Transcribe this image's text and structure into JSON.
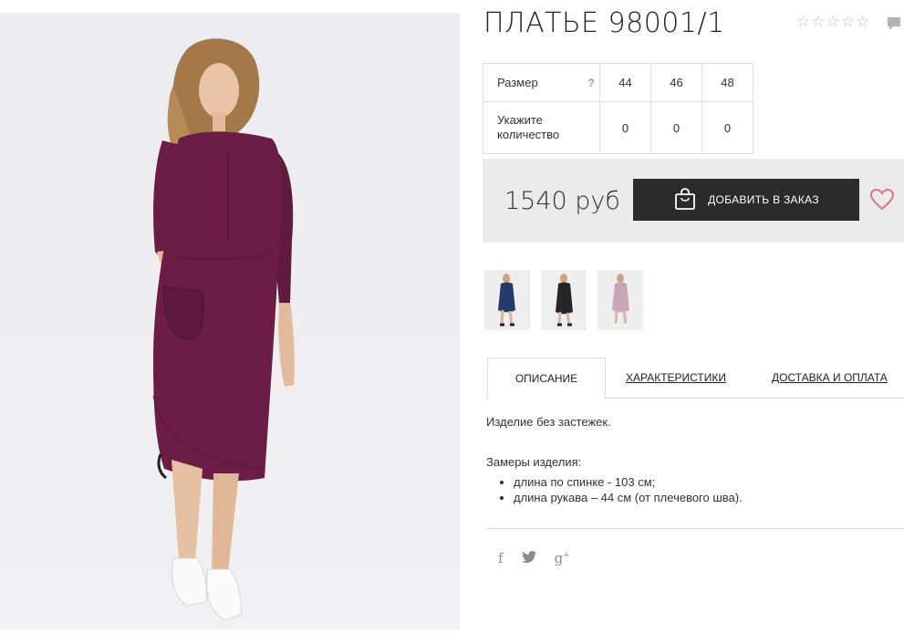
{
  "product": {
    "title": "ПЛАТЬЕ 98001/1",
    "rating_stars": 5
  },
  "sizes": {
    "size_label": "Размер",
    "help_label": "?",
    "qty_label": "Укажите количество",
    "columns": [
      {
        "size": "44",
        "qty": "0"
      },
      {
        "size": "46",
        "qty": "0"
      },
      {
        "size": "48",
        "qty": "0"
      }
    ]
  },
  "buy": {
    "price": "1540 руб",
    "add_label": "ДОБАВИТЬ В ЗАКАЗ"
  },
  "thumbnails": [
    {
      "color_name": "navy",
      "color": "#243a6b"
    },
    {
      "color_name": "black",
      "color": "#262626"
    },
    {
      "color_name": "pink",
      "color": "#c7a6b6"
    }
  ],
  "tabs": {
    "description": "ОПИСАНИЕ",
    "characteristics": "ХАРАКТЕРИСТИКИ",
    "delivery": "ДОСТАВКА И ОПЛАТА"
  },
  "description": {
    "line1": "Изделие без застежек.",
    "measures_title": "Замеры изделия:",
    "measures": [
      "длина по спинке - 103 см;",
      "длина рукава – 44 см (от плечевого шва)."
    ]
  },
  "colors": {
    "dress": "#6b1d45",
    "button_bg": "#2b2b2b",
    "heart": "#d9797e"
  },
  "icons": [
    "star-icon",
    "comment-icon",
    "bag-icon",
    "heart-icon",
    "facebook-icon",
    "twitter-icon",
    "google-plus-icon"
  ]
}
